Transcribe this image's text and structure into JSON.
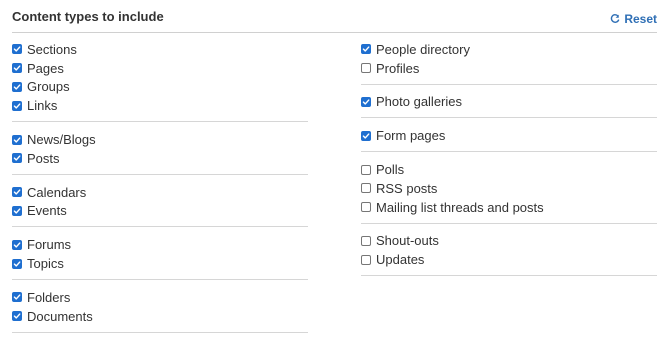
{
  "header": {
    "title": "Content types to include",
    "reset_label": "Reset"
  },
  "colors": {
    "accent": "#1f6fd0",
    "link": "#2f6fb5"
  },
  "left_groups": [
    {
      "items": [
        {
          "label": "Sections",
          "checked": true
        },
        {
          "label": "Pages",
          "checked": true
        },
        {
          "label": "Groups",
          "checked": true
        },
        {
          "label": "Links",
          "checked": true
        }
      ]
    },
    {
      "items": [
        {
          "label": "News/Blogs",
          "checked": true
        },
        {
          "label": "Posts",
          "checked": true
        }
      ]
    },
    {
      "items": [
        {
          "label": "Calendars",
          "checked": true
        },
        {
          "label": "Events",
          "checked": true
        }
      ]
    },
    {
      "items": [
        {
          "label": "Forums",
          "checked": true
        },
        {
          "label": "Topics",
          "checked": true
        }
      ]
    },
    {
      "items": [
        {
          "label": "Folders",
          "checked": true
        },
        {
          "label": "Documents",
          "checked": true
        }
      ]
    }
  ],
  "right_groups": [
    {
      "items": [
        {
          "label": "People directory",
          "checked": true
        },
        {
          "label": "Profiles",
          "checked": false
        }
      ]
    },
    {
      "items": [
        {
          "label": "Photo galleries",
          "checked": true
        }
      ]
    },
    {
      "items": [
        {
          "label": "Form pages",
          "checked": true
        }
      ]
    },
    {
      "items": [
        {
          "label": "Polls",
          "checked": false
        },
        {
          "label": "RSS posts",
          "checked": false
        },
        {
          "label": "Mailing list threads and posts",
          "checked": false
        }
      ]
    },
    {
      "items": [
        {
          "label": "Shout-outs",
          "checked": false
        },
        {
          "label": "Updates",
          "checked": false
        }
      ]
    }
  ]
}
